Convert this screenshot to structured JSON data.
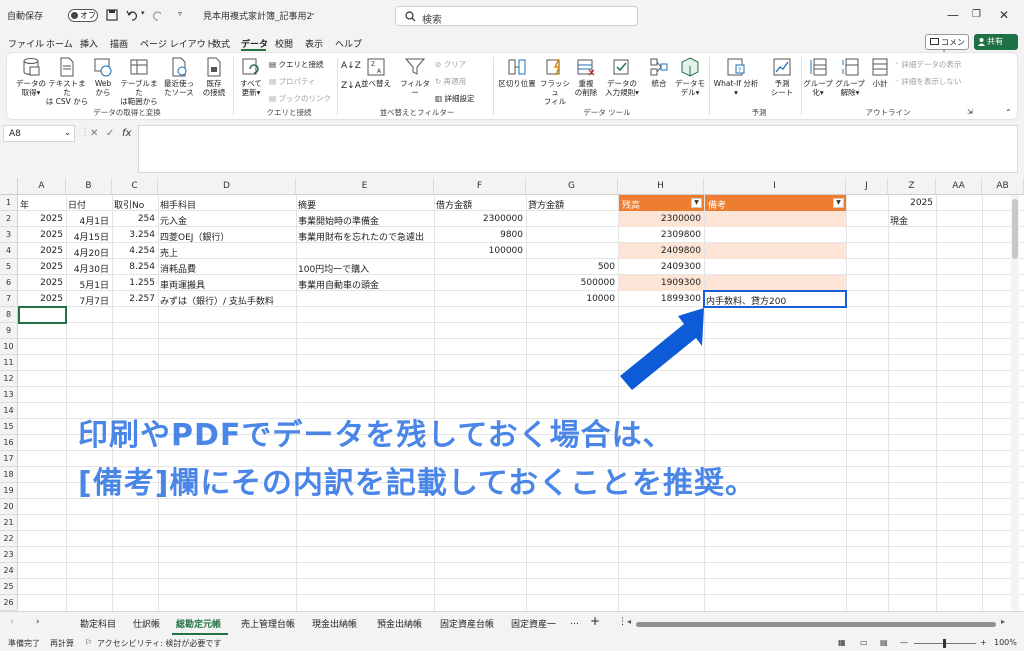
{
  "titlebar": {
    "autosave_label": "自動保存",
    "autosave_state": "オフ",
    "file_name": "見本用複式家計簿_記事用2",
    "search_placeholder": "検索"
  },
  "menu": [
    "ファイル",
    "ホーム",
    "挿入",
    "描画",
    "ページ レイアウト",
    "数式",
    "データ",
    "校閲",
    "表示",
    "ヘルプ"
  ],
  "menu_active": "データ",
  "comment_label": "コメント",
  "share_label": "共有",
  "ribbon": {
    "get_data": [
      {
        "label1": "データの",
        "label2": "取得"
      },
      {
        "label1": "テキストまた",
        "label2": "は CSV から"
      },
      {
        "label1": "Web",
        "label2": "から"
      },
      {
        "label1": "テーブルまた",
        "label2": "は範囲から"
      },
      {
        "label1": "最近使っ",
        "label2": "たソース"
      },
      {
        "label1": "既存",
        "label2": "の接続"
      }
    ],
    "get_data_group": "データの取得と変換",
    "refresh": {
      "label1": "すべて",
      "label2": "更新"
    },
    "queries": [
      "クエリと接続",
      "プロパティ",
      "ブックのリンク"
    ],
    "queries_group": "クエリと接続",
    "sort_filter": {
      "sort": "並べ替え",
      "filter": "フィルター",
      "clear": "クリア",
      "reapply": "再適用",
      "advanced": "詳細設定"
    },
    "sort_filter_group": "並べ替えとフィルター",
    "tools": [
      {
        "label1": "区切り位置",
        "label2": ""
      },
      {
        "label1": "フラッシュ",
        "label2": "フィル"
      },
      {
        "label1": "重複",
        "label2": "の削除"
      },
      {
        "label1": "データの",
        "label2": "入力規則"
      },
      {
        "label1": "統合",
        "label2": ""
      },
      {
        "label1": "データモ",
        "label2": "デル"
      }
    ],
    "tools_group": "データ ツール",
    "forecast": [
      {
        "label1": "What-If 分析",
        "label2": ""
      },
      {
        "label1": "予測",
        "label2": "シート"
      }
    ],
    "forecast_group": "予測",
    "outline": [
      {
        "label1": "グループ",
        "label2": "化"
      },
      {
        "label1": "グループ",
        "label2": "解除"
      },
      {
        "label1": "小計",
        "label2": ""
      }
    ],
    "outline_small": [
      "詳細データの表示",
      "詳細を表示しない"
    ],
    "outline_group": "アウトライン"
  },
  "namebox": "A8",
  "columns": [
    "A",
    "B",
    "C",
    "D",
    "E",
    "F",
    "G",
    "H",
    "I",
    "J",
    "Z",
    "AA",
    "AB"
  ],
  "rows": [
    "1",
    "2",
    "3",
    "4",
    "5",
    "6",
    "7",
    "8",
    "9",
    "10",
    "11",
    "12",
    "13",
    "14",
    "15",
    "16",
    "17",
    "18",
    "19",
    "20",
    "21",
    "22",
    "23",
    "24",
    "25",
    "26"
  ],
  "headers": {
    "year": "年",
    "date": "日付",
    "txno": "取引No",
    "account": "相手科目",
    "summary": "摘要",
    "debit": "借方金額",
    "credit": "貸方金額",
    "balance": "残高",
    "note": "備考"
  },
  "table": [
    {
      "year": "2025",
      "date": "4月1日",
      "no": "254",
      "account": "元入金",
      "summary": "事業開始時の準備金",
      "debit": "2300000",
      "credit": "",
      "balance": "2300000",
      "note": ""
    },
    {
      "year": "2025",
      "date": "4月15日",
      "no": "3.254",
      "account": "四菱OEJ（銀行）",
      "summary": "事業用財布を忘れたので急遽出",
      "debit": "9800",
      "credit": "",
      "balance": "2309800",
      "note": ""
    },
    {
      "year": "2025",
      "date": "4月20日",
      "no": "4.254",
      "account": "売上",
      "summary": "",
      "debit": "100000",
      "credit": "",
      "balance": "2409800",
      "note": ""
    },
    {
      "year": "2025",
      "date": "4月30日",
      "no": "8.254",
      "account": "消耗品費",
      "summary": "100円均一で購入",
      "debit": "",
      "credit": "500",
      "balance": "2409300",
      "note": ""
    },
    {
      "year": "2025",
      "date": "5月1日",
      "no": "1.255",
      "account": "車両運搬具",
      "summary": "事業用自動車の頭金",
      "debit": "",
      "credit": "500000",
      "balance": "1909300",
      "note": ""
    },
    {
      "year": "2025",
      "date": "7月7日",
      "no": "2.257",
      "account": "みずは（銀行）/ 支払手数料",
      "summary": "",
      "debit": "",
      "credit": "10000",
      "balance": "1899300",
      "note": "内手数料、貸方200"
    }
  ],
  "z_col": {
    "z1": "2025",
    "z2": "現金"
  },
  "callout": {
    "line1": "印刷やPDFでデータを残しておく場合は、",
    "line2": "[備考]欄にその内訳を記載しておくことを推奨。"
  },
  "sheets": [
    "勘定科目",
    "仕訳帳",
    "総勘定元帳",
    "売上管理台帳",
    "現金出納帳",
    "預金出納帳",
    "固定資産台帳",
    "固定資産一"
  ],
  "active_sheet": "総勘定元帳",
  "status": {
    "ready": "準備完了",
    "recalc": "再計算",
    "accessibility": "アクセシビリティ: 検討が必要です",
    "zoom": "100%"
  },
  "colors": {
    "accent": "#217346",
    "orange": "#ed7d31",
    "peach": "#fce4d6",
    "callout": "#4a86e8",
    "arrow": "#0d5bd6"
  }
}
